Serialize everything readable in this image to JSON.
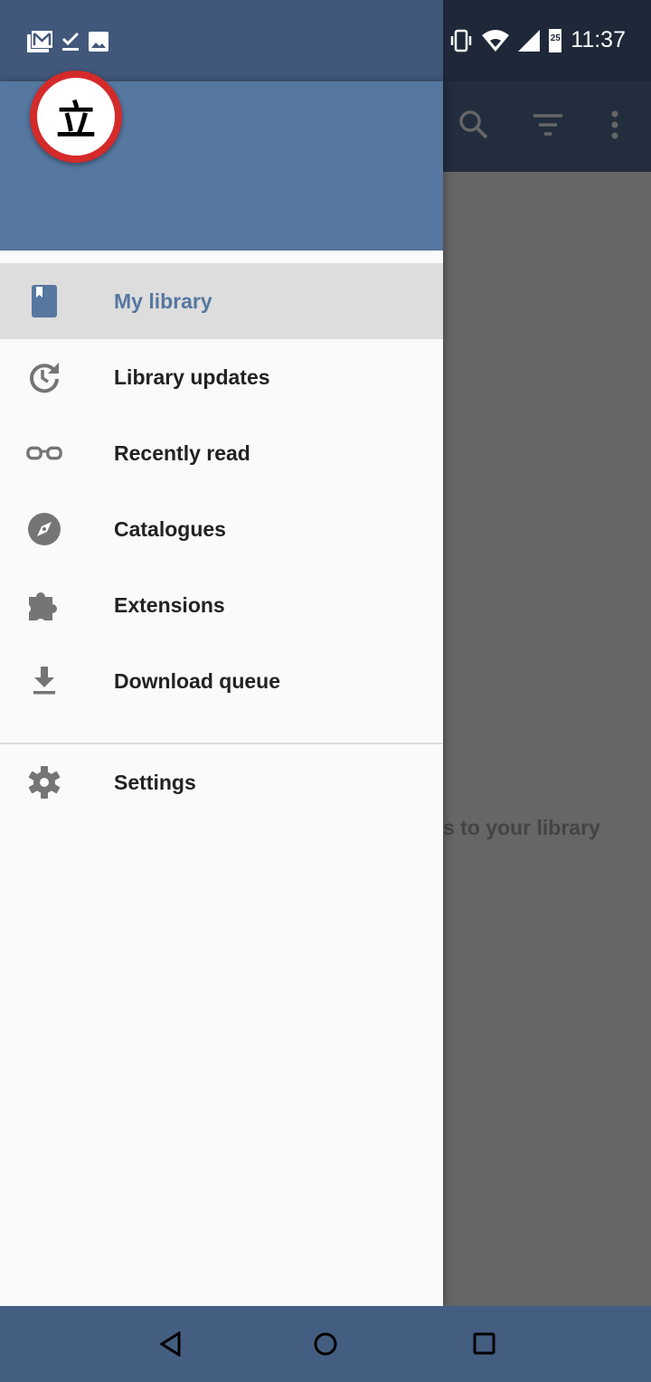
{
  "status_bar": {
    "time": "11:37",
    "battery_level": "25",
    "notification_icons": [
      "gmail-icon",
      "check-icon",
      "image-icon"
    ],
    "system_icons": [
      "vibrate-icon",
      "wifi-icon",
      "signal-icon",
      "battery-icon"
    ]
  },
  "toolbar": {
    "icons": [
      "search-icon",
      "filter-icon",
      "more-vert-icon"
    ]
  },
  "content": {
    "empty_text": "s to your library"
  },
  "drawer": {
    "logo_char": "立",
    "items": [
      {
        "label": "My library",
        "icon": "book-icon",
        "selected": true
      },
      {
        "label": "Library updates",
        "icon": "update-icon"
      },
      {
        "label": "Recently read",
        "icon": "glasses-icon"
      },
      {
        "label": "Catalogues",
        "icon": "compass-icon"
      },
      {
        "label": "Extensions",
        "icon": "puzzle-icon"
      },
      {
        "label": "Download queue",
        "icon": "download-icon"
      }
    ],
    "settings": {
      "label": "Settings",
      "icon": "gear-icon"
    }
  },
  "colors": {
    "accent": "#5577a0",
    "status_bar": "#41587a",
    "nav_bar": "#445e82",
    "selected_bg": "#dddddd"
  }
}
